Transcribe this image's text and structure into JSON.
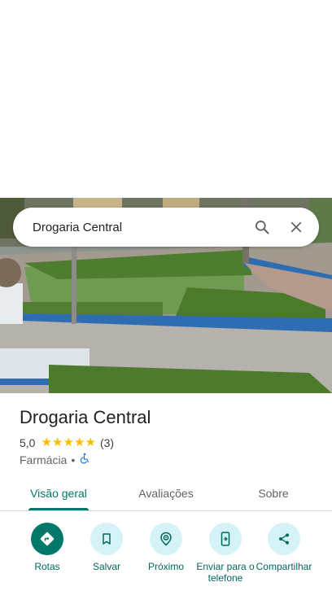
{
  "search": {
    "query": "Drogaria Central"
  },
  "place": {
    "name": "Drogaria Central",
    "rating": "5,0",
    "stars": 5,
    "review_count": "(3)",
    "category": "Farmácia",
    "separator": "•"
  },
  "tabs": [
    {
      "label": "Visão geral",
      "active": true
    },
    {
      "label": "Avaliações"
    },
    {
      "label": "Sobre"
    }
  ],
  "actions": [
    {
      "label": "Rotas",
      "icon": "directions-icon"
    },
    {
      "label": "Salvar",
      "icon": "bookmark-icon"
    },
    {
      "label": "Próximo",
      "icon": "nearby-icon"
    },
    {
      "label": "Enviar para o telefone",
      "icon": "send-to-phone-icon"
    },
    {
      "label": "Compartilhar",
      "icon": "share-icon"
    }
  ],
  "colors": {
    "accent": "#00796b",
    "star": "#fbbc04",
    "action_bg": "#d5f3f6"
  }
}
